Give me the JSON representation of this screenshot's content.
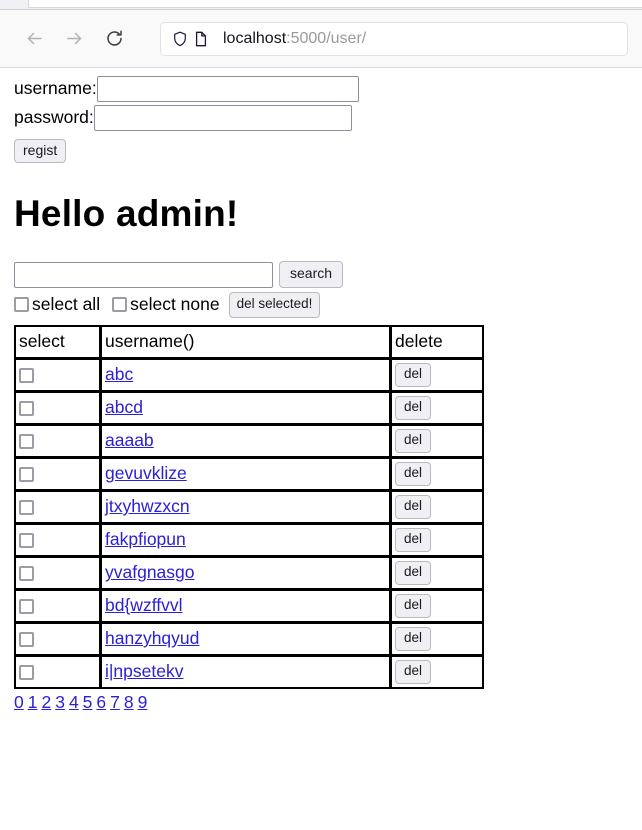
{
  "browser": {
    "back_icon": "arrow-left-icon",
    "forward_icon": "arrow-right-icon",
    "reload_icon": "reload-icon",
    "shield_icon": "shield-icon",
    "page_icon": "page-document-icon",
    "url_host": "localhost",
    "url_rest": ":5000/user/"
  },
  "register_form": {
    "username_label": "username:",
    "username_value": "",
    "password_label": "password:",
    "password_value": "",
    "submit_label": "regist"
  },
  "greeting": "Hello admin!",
  "search": {
    "value": "",
    "button_label": "search"
  },
  "bulk": {
    "select_all_label": "select all",
    "select_none_label": "select none",
    "delete_selected_label": "del selected!"
  },
  "table": {
    "headers": {
      "select": "select",
      "username": "username()",
      "delete": "delete"
    },
    "delete_button_label": "del",
    "rows": [
      {
        "username": "abc",
        "checked": false
      },
      {
        "username": "abcd",
        "checked": false
      },
      {
        "username": "aaaab",
        "checked": false
      },
      {
        "username": "gevuvklize",
        "checked": false
      },
      {
        "username": "jtxyhwzxcn",
        "checked": false
      },
      {
        "username": "fakpfiopun",
        "checked": false
      },
      {
        "username": "yvafgnasgo",
        "checked": false
      },
      {
        "username": "bd{wzffvvl",
        "checked": false
      },
      {
        "username": "hanzyhqyud",
        "checked": false
      },
      {
        "username": "i|npsetekv",
        "checked": false
      }
    ]
  },
  "pagination": {
    "pages": [
      "0",
      "1",
      "2",
      "3",
      "4",
      "5",
      "6",
      "7",
      "8",
      "9"
    ]
  },
  "colors": {
    "link": "#2a21d6",
    "text": "#000000",
    "chrome_bg": "#f9f9fa",
    "button_bg": "#f0f0f4"
  }
}
